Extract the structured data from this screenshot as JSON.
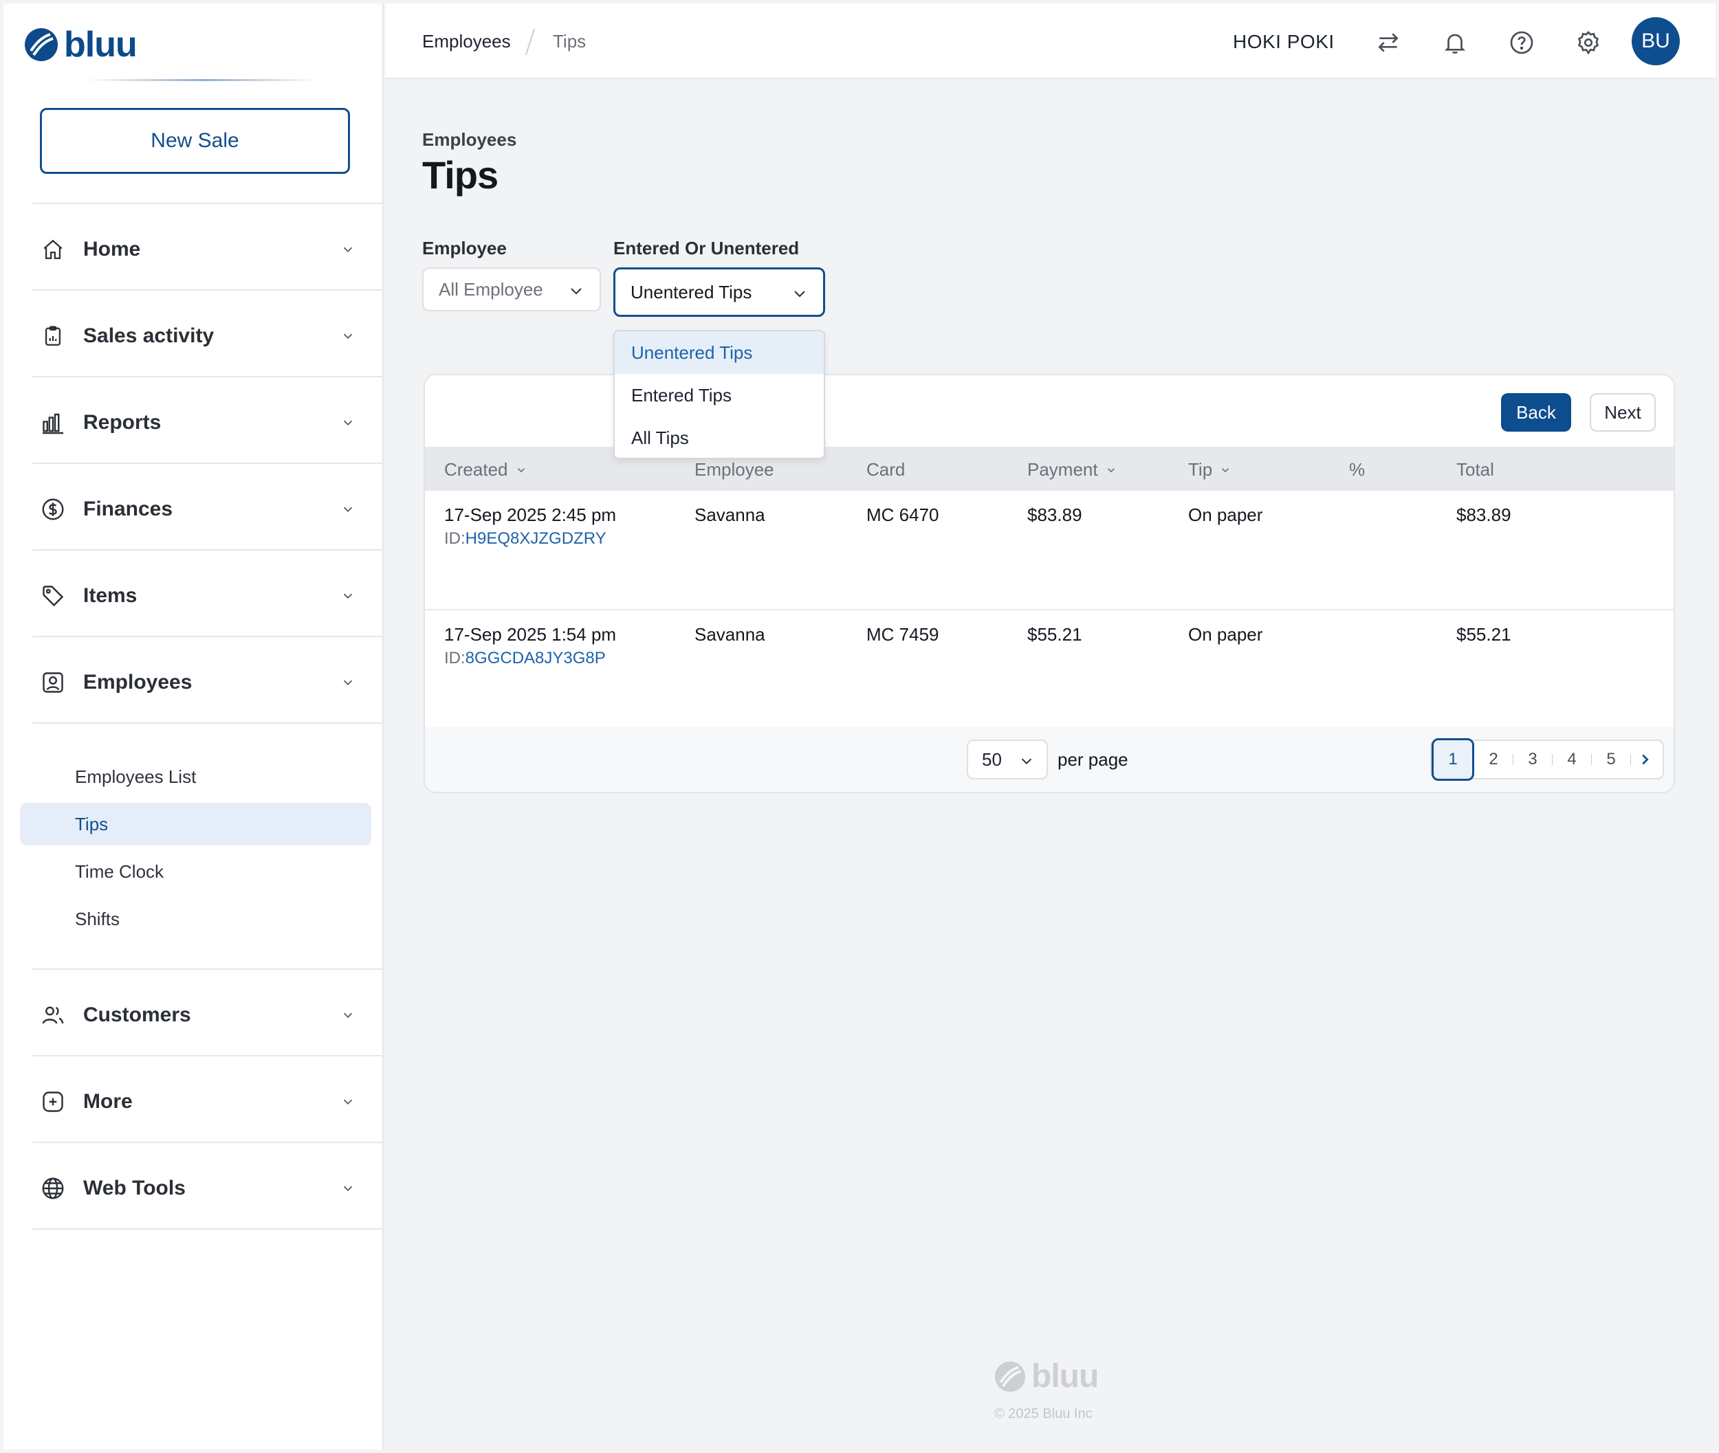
{
  "brand": {
    "name": "bluu",
    "primary_color": "#0e4d8e",
    "copyright": "© 2025 Bluu Inc"
  },
  "sidebar": {
    "new_sale_label": "New Sale",
    "nav": [
      {
        "label": "Home",
        "icon": "home-icon"
      },
      {
        "label": "Sales activity",
        "icon": "clipboard-icon"
      },
      {
        "label": "Reports",
        "icon": "bar-chart-icon"
      },
      {
        "label": "Finances",
        "icon": "dollar-circle-icon"
      },
      {
        "label": "Items",
        "icon": "tag-icon"
      },
      {
        "label": "Employees",
        "icon": "user-badge-icon"
      },
      {
        "label": "Customers",
        "icon": "users-icon"
      },
      {
        "label": "More",
        "icon": "plus-square-icon"
      },
      {
        "label": "Web Tools",
        "icon": "globe-icon"
      }
    ],
    "employees_sub": [
      {
        "label": "Employees List",
        "active": false
      },
      {
        "label": "Tips",
        "active": true
      },
      {
        "label": "Time Clock",
        "active": false
      },
      {
        "label": "Shifts",
        "active": false
      }
    ]
  },
  "topbar": {
    "breadcrumb": [
      "Employees",
      "Tips"
    ],
    "store_name": "HOKI POKI",
    "avatar_initials": "BU",
    "icons": [
      "swap-icon",
      "bell-icon",
      "help-icon",
      "gear-icon"
    ]
  },
  "page": {
    "subtitle": "Employees",
    "title": "Tips"
  },
  "filters": {
    "employee": {
      "label": "Employee",
      "value": "All Employee"
    },
    "entered": {
      "label": "Entered Or Unentered",
      "value": "Unentered Tips",
      "options": [
        "Unentered Tips",
        "Entered Tips",
        "All Tips"
      ]
    }
  },
  "table": {
    "back_label": "Back",
    "next_label": "Next",
    "columns": [
      "Created",
      "Employee",
      "Card",
      "Payment",
      "Tip",
      "%",
      "Total"
    ],
    "rows": [
      {
        "created": "17-Sep 2025 2:45 pm",
        "id_prefix": "ID:",
        "id": "H9EQ8XJZGDZRY",
        "employee": "Savanna",
        "card": "MC 6470",
        "payment": "$83.89",
        "tip": "On paper",
        "percent": "",
        "total": "$83.89"
      },
      {
        "created": "17-Sep 2025 1:54 pm",
        "id_prefix": "ID:",
        "id": "8GGCDA8JY3G8P",
        "employee": "Savanna",
        "card": "MC 7459",
        "payment": "$55.21",
        "tip": "On paper",
        "percent": "",
        "total": "$55.21"
      }
    ],
    "per_page_value": "50",
    "per_page_label": "per page",
    "pages": [
      "1",
      "2",
      "3",
      "4",
      "5"
    ],
    "current_page": "1"
  }
}
